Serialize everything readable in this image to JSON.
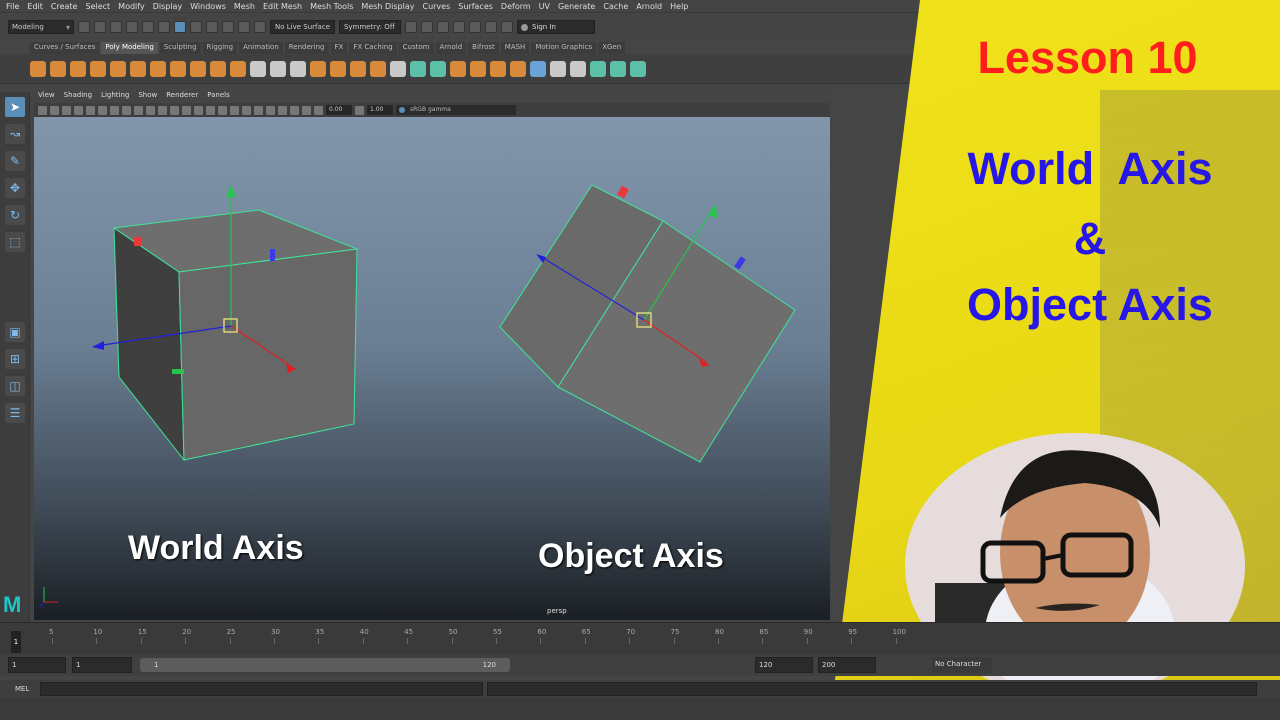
{
  "menu": [
    "File",
    "Edit",
    "Create",
    "Select",
    "Modify",
    "Display",
    "Windows",
    "Mesh",
    "Edit Mesh",
    "Mesh Tools",
    "Mesh Display",
    "Curves",
    "Surfaces",
    "Deform",
    "UV",
    "Generate",
    "Cache",
    "Arnold",
    "Help"
  ],
  "status": {
    "mode": "Modeling",
    "live_surface": "No Live Surface",
    "symmetry": "Symmetry: Off",
    "sign_in": "Sign In"
  },
  "shelf_tabs": [
    "Curves / Surfaces",
    "Poly Modeling",
    "Sculpting",
    "Rigging",
    "Animation",
    "Rendering",
    "FX",
    "FX Caching",
    "Custom",
    "Arnold",
    "Bifrost",
    "MASH",
    "Motion Graphics",
    "XGen"
  ],
  "active_shelf": "Poly Modeling",
  "panel_menu": [
    "View",
    "Shading",
    "Lighting",
    "Show",
    "Renderer",
    "Panels"
  ],
  "panel_toolbar": {
    "value1": "0.00",
    "value2": "1.00",
    "color_space": "sRGB gamma"
  },
  "viewport": {
    "camera": "persp",
    "label_left": "World Axis",
    "label_right": "Object Axis"
  },
  "overlay": {
    "lesson": "Lesson 10",
    "line1": "World  Axis",
    "line2": "&",
    "line3": "Object Axis"
  },
  "timeline": {
    "ticks": [
      "5",
      "10",
      "15",
      "20",
      "25",
      "30",
      "35",
      "40",
      "45",
      "50",
      "55",
      "60",
      "65",
      "70",
      "75",
      "80",
      "85",
      "90",
      "95",
      "100"
    ],
    "current_frame": "1"
  },
  "range": {
    "start": "1",
    "playback_start": "1",
    "slider_start": "1",
    "slider_end": "120",
    "playback_end": "120",
    "end": "200",
    "character": "No Character"
  },
  "cmd": {
    "mel": "MEL"
  },
  "colors": {
    "title_red": "#ff1d1d",
    "title_blue": "#2616e8",
    "overlay_yellow": "#f0e31a",
    "selection_green": "#3fe39a"
  }
}
